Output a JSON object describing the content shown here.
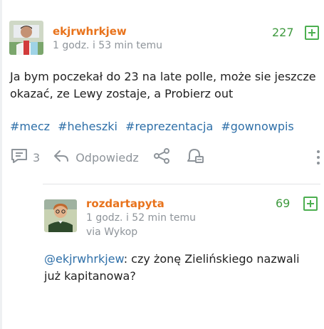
{
  "post": {
    "author": "ekjrwhrkjew",
    "time": "1 godz. i 53 min temu",
    "score": "227",
    "body": "Ja bym poczekał do 23 na late polle, może sie jeszcze okazać, ze Lewy zostaje, a Probierz out",
    "tags": [
      "#mecz",
      "#heheszki",
      "#reprezentacja",
      "#gownowpis"
    ],
    "comments_count": "3",
    "reply_label": "Odpowiedz"
  },
  "comment": {
    "author": "rozdartapyta",
    "time": "1 godz. i 52 min temu",
    "via": "via Wykop",
    "score": "69",
    "mention": "@ekjrwhrkjew",
    "text": ": czy żonę Zielińskiego nazwali już kapitanowa?"
  },
  "colors": {
    "username": "#e8731c",
    "score": "#3f9a3f",
    "tag": "#2e6fa8",
    "meta": "#8e949a"
  },
  "icons": [
    "comment-icon",
    "reply-icon",
    "share-icon",
    "notification-icon",
    "more-icon",
    "plus-icon"
  ]
}
